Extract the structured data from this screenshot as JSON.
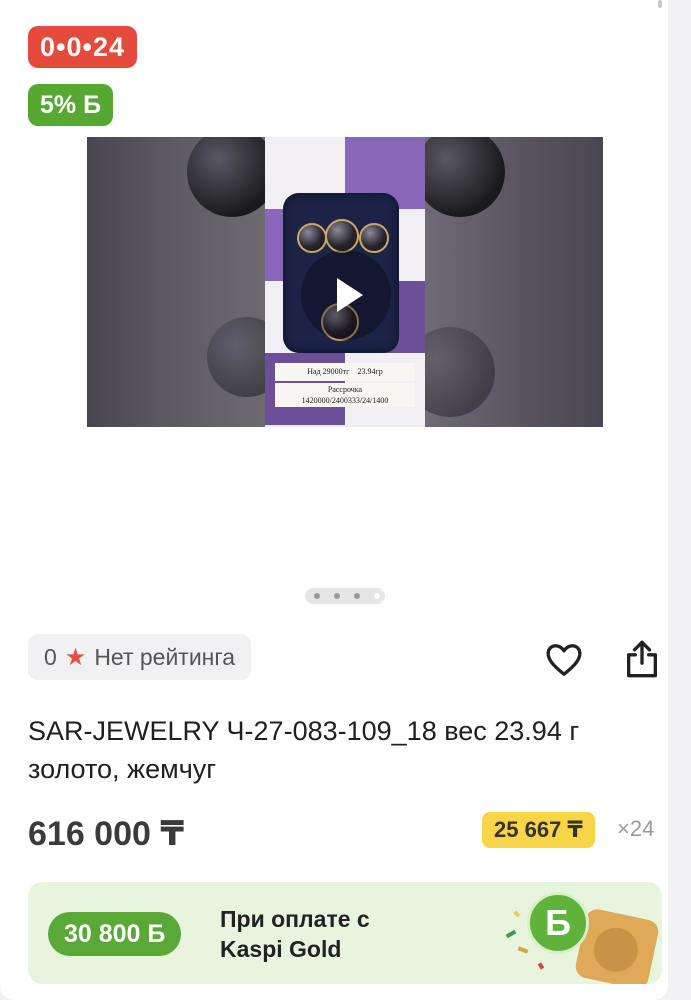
{
  "product": {
    "promo_badge": "0•0•24",
    "bonus_badge": "5% Б",
    "media": {
      "label_top": "Над 29000тг",
      "label_weight": "23.94гр",
      "label_bottom_1": "Рассрочка",
      "label_bottom_2": "1420000/2400333/24/1400"
    },
    "rating": {
      "count": "0",
      "text": "Нет рейтинга"
    },
    "title": "SAR-JEWELRY Ч-27-083-109_18 вес 23.94 г золото, жемчуг",
    "price": "616 000 ₸",
    "installment": {
      "amount": "25 667 ₸",
      "months": "×24"
    },
    "kaspi_gold": {
      "bonus": "30 800 Б",
      "line1": "При оплате с",
      "line2": "Kaspi Gold",
      "logo_letter": "Б"
    }
  },
  "colors": {
    "promo_red": "#e54b3c",
    "bonus_green": "#56a832",
    "installment_yellow": "#f7d546",
    "kaspi_bg": "#e7f4de",
    "rating_star": "#e5503f"
  },
  "icons": [
    "play-icon",
    "star-icon",
    "heart-icon",
    "share-icon",
    "kaspi-bonus-icon"
  ],
  "carousel": {
    "total_slides": 4,
    "active_slide": 4
  }
}
